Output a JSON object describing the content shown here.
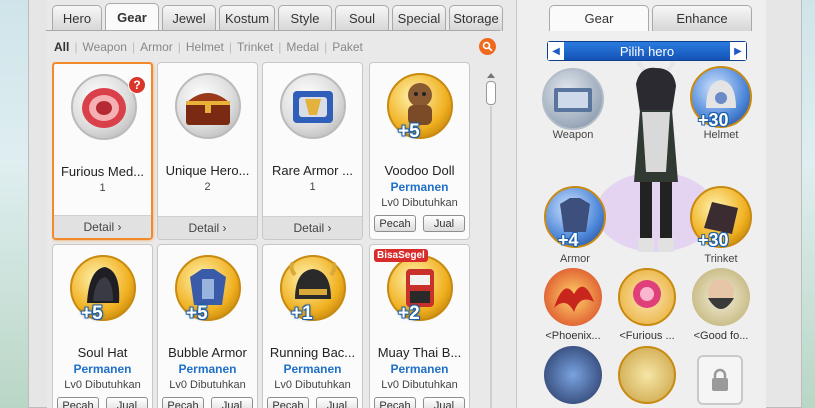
{
  "tabs": [
    "Hero",
    "Gear",
    "Jewel",
    "Kostum",
    "Style",
    "Soul",
    "Special",
    "Storage"
  ],
  "active_tab": "Gear",
  "filters": [
    "All",
    "Weapon",
    "Armor",
    "Helmet",
    "Trinket",
    "Medal",
    "Paket"
  ],
  "active_filter": "All",
  "cards": [
    {
      "name": "Furious Med...",
      "count": "1",
      "button": "Detail",
      "art": "medal-icon"
    },
    {
      "name": "Unique Hero...",
      "count": "2",
      "button": "Detail",
      "art": "chest-icon"
    },
    {
      "name": "Rare Armor ...",
      "count": "1",
      "button": "Detail",
      "art": "armor-box-icon"
    },
    {
      "name": "Voodoo Doll",
      "plus": "+5",
      "status": "Permanen",
      "req": "Lv0 Dibutuhkan",
      "b1": "Pecah",
      "b2": "Jual",
      "art": "voodoo-doll-icon"
    },
    {
      "name": "Soul Hat",
      "plus": "+5",
      "status": "Permanen",
      "req": "Lv0 Dibutuhkan",
      "b1": "Pecah",
      "b2": "Jual",
      "art": "hat-icon"
    },
    {
      "name": "Bubble Armor",
      "plus": "+5",
      "status": "Permanen",
      "req": "Lv0 Dibutuhkan",
      "b1": "Pecah",
      "b2": "Jual",
      "art": "armor-icon"
    },
    {
      "name": "Running Bac...",
      "plus": "+1",
      "status": "Permanen",
      "req": "Lv0 Dibutuhkan",
      "b1": "Pecah",
      "b2": "Jual",
      "art": "helmet-icon"
    },
    {
      "name": "Muay Thai B...",
      "plus": "+2",
      "status": "Permanen",
      "req": "Lv0 Dibutuhkan",
      "b1": "Pecah",
      "b2": "Jual",
      "badge": "BisaSegel",
      "art": "muay-thai-icon"
    }
  ],
  "right": {
    "tabs": [
      "Gear",
      "Enhance"
    ],
    "active_tab": "Gear",
    "hero_select": "Pilih hero",
    "slots": {
      "weapon": {
        "label": "Weapon"
      },
      "helmet": {
        "label": "Helmet",
        "plus": "+30"
      },
      "armor": {
        "label": "Armor",
        "plus": "+4"
      },
      "trinket": {
        "label": "Trinket",
        "plus": "+30"
      }
    },
    "soul_slots": [
      {
        "label": "<Phoenix...",
        "art": "phoenix-icon"
      },
      {
        "label": "<Furious ...",
        "art": "rare-gem-icon"
      },
      {
        "label": "<Good fo...",
        "art": "bearded-man-icon"
      }
    ]
  },
  "colors": {
    "accent": "#f28a2c",
    "perm": "#1f70c9",
    "hero_select": "#1e5cc4"
  }
}
